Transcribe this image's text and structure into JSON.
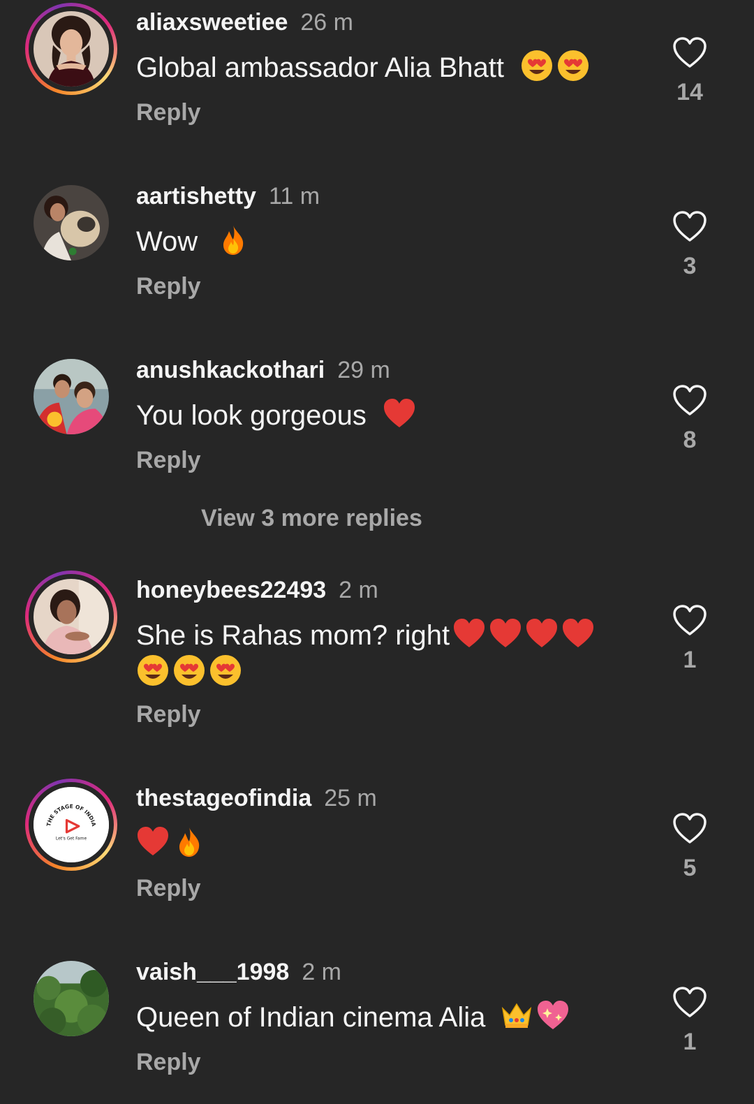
{
  "colors": {
    "background": "#262626",
    "primary_text": "#f5f5f5",
    "secondary_text": "#a8a8a8",
    "story_ring_gradient": [
      "#f58529",
      "#dd2a7b",
      "#8134af",
      "#feda77"
    ]
  },
  "icons": {
    "like": "heart-outline-icon",
    "heart_eyes": "heart-eyes-emoji",
    "fire": "fire-emoji",
    "red_heart": "red-heart-emoji",
    "crown": "crown-emoji",
    "sparkling_heart": "sparkling-heart-emoji"
  },
  "comments": [
    {
      "username": "aliaxsweetiee",
      "time": "26 m",
      "text": "Global ambassador Alia Bhatt",
      "emojis": [
        "heart_eyes",
        "heart_eyes"
      ],
      "reply_label": "Reply",
      "likes": "14",
      "story_ring": true
    },
    {
      "username": "aartishetty",
      "time": "11 m",
      "text": "Wow",
      "emojis": [
        "fire"
      ],
      "reply_label": "Reply",
      "likes": "3",
      "story_ring": false
    },
    {
      "username": "anushkackothari",
      "time": "29 m",
      "text": "You look gorgeous",
      "emojis": [
        "red_heart"
      ],
      "reply_label": "Reply",
      "likes": "8",
      "story_ring": false
    },
    {
      "username": "honeybees22493",
      "time": "2 m",
      "text": "She is Rahas mom? right",
      "emojis": [
        "red_heart",
        "red_heart",
        "red_heart",
        "red_heart",
        "heart_eyes",
        "heart_eyes",
        "heart_eyes"
      ],
      "reply_label": "Reply",
      "likes": "1",
      "story_ring": true
    },
    {
      "username": "thestageofindia",
      "time": "25 m",
      "text": "",
      "emojis": [
        "red_heart",
        "fire"
      ],
      "reply_label": "Reply",
      "likes": "5",
      "story_ring": true,
      "avatar_logo": {
        "title": "THE STAGE OF INDIA",
        "tagline": "Let's Get Fame"
      }
    },
    {
      "username": "vaish___1998",
      "time": "2 m",
      "text": "Queen of Indian cinema Alia",
      "emojis": [
        "crown",
        "sparkling_heart"
      ],
      "reply_label": "Reply",
      "likes": "1",
      "story_ring": false
    }
  ],
  "view_more_replies": "View 3 more replies"
}
